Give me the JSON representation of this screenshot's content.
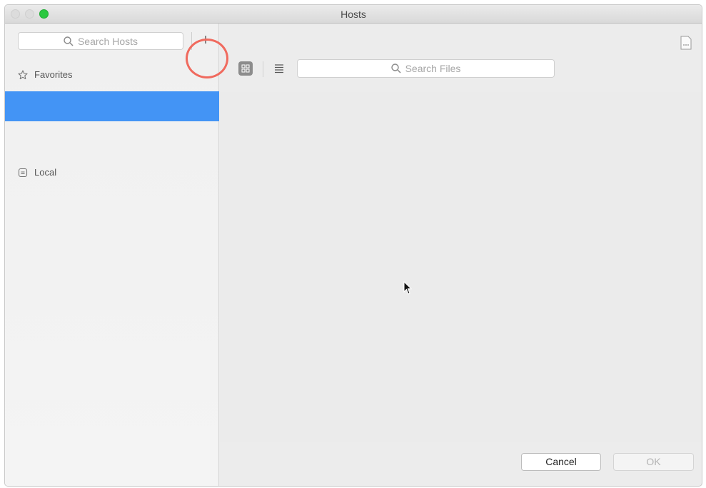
{
  "window": {
    "title": "Hosts"
  },
  "sidebar": {
    "search_placeholder": "Search Hosts",
    "add_label": "+",
    "favorites_label": "Favorites",
    "local_label": "Local"
  },
  "main": {
    "search_placeholder": "Search Files"
  },
  "footer": {
    "cancel_label": "Cancel",
    "ok_label": "OK"
  },
  "colors": {
    "selection": "#4394f5",
    "highlight_circle": "#f06a5e",
    "zoom_button": "#2bc840"
  },
  "icons": [
    "search-icon",
    "star-icon",
    "drive-icon",
    "grid-view-icon",
    "list-view-icon",
    "file-info-icon",
    "cursor-icon"
  ]
}
